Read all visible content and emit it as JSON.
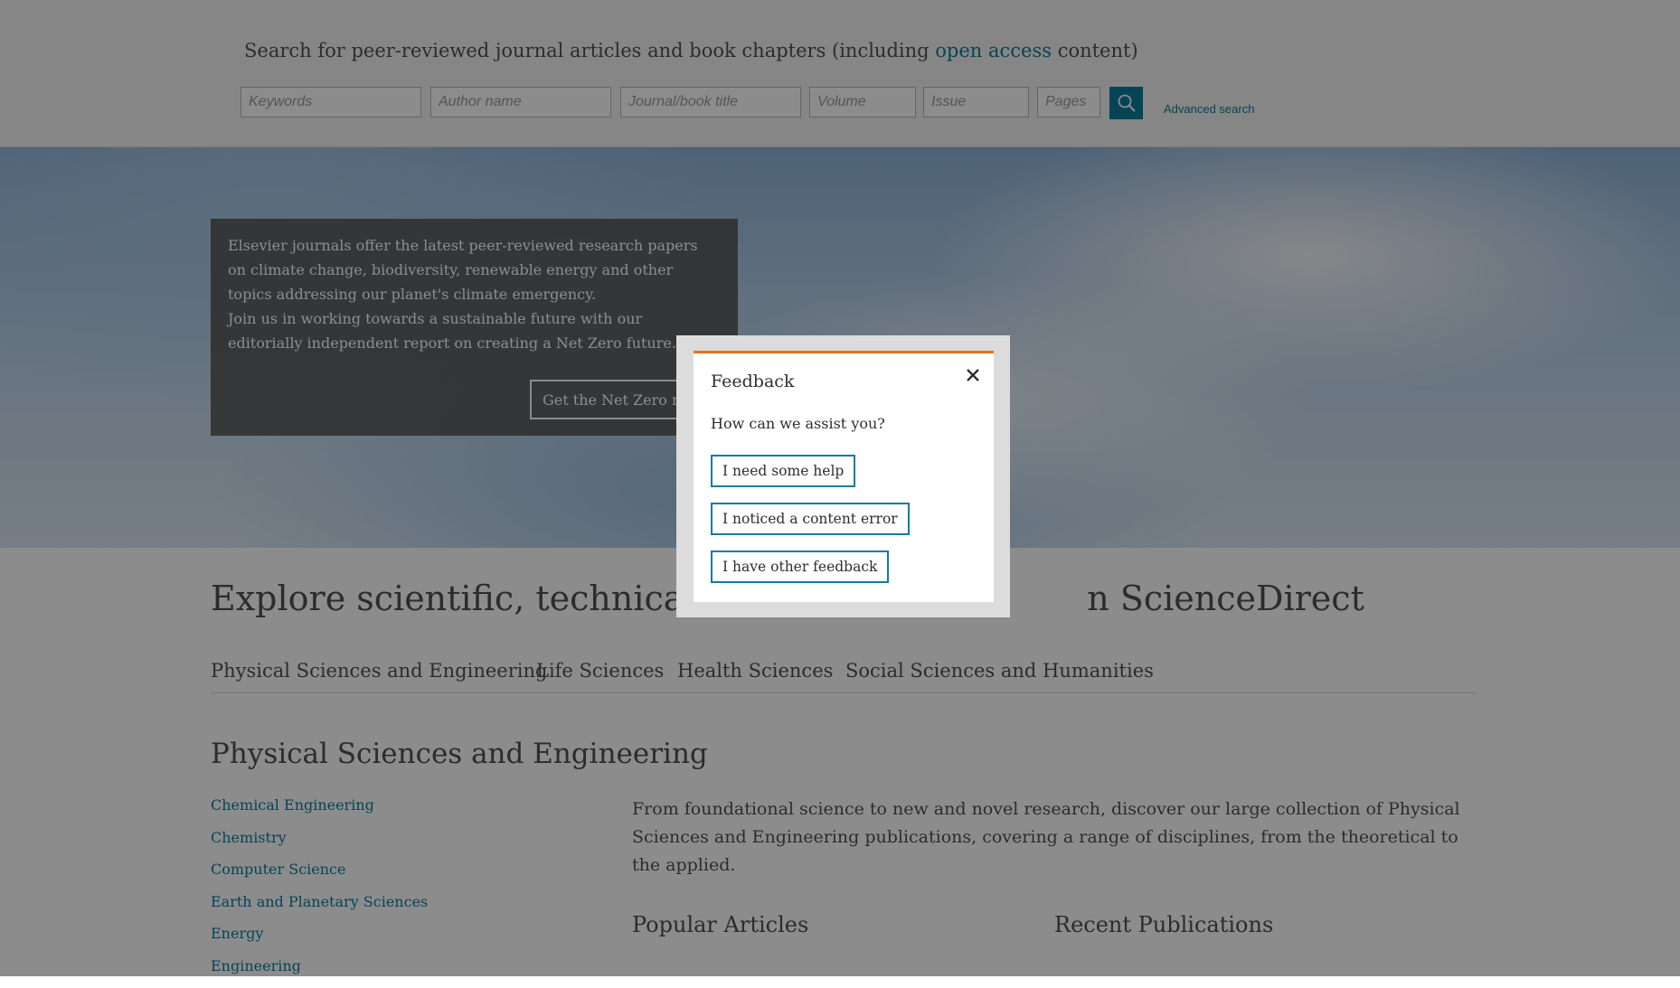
{
  "search": {
    "intro_prefix": "Search for peer-reviewed journal articles and book chapters (including ",
    "intro_link": "open access",
    "intro_suffix": " content)",
    "keywords_placeholder": "Keywords",
    "author_placeholder": "Author name",
    "journal_placeholder": "Journal/book title",
    "volume_placeholder": "Volume",
    "issue_placeholder": "Issue",
    "pages_placeholder": "Pages",
    "submit_icon": "search-icon",
    "advanced_label": "Advanced search"
  },
  "hero": {
    "paragraph1": "Elsevier journals offer the latest peer-reviewed research papers on climate change, biodiversity, renewable energy and other topics addressing our planet's climate emergency.",
    "paragraph2": "Join us in working towards a sustainable future with our editorially independent report on creating a Net Zero future.",
    "button_label": "Get the Net Zero re"
  },
  "explore": {
    "title": "Explore scientific, technical, an                              n ScienceDirect",
    "tabs": [
      {
        "label": "Physical Sciences and Engineering"
      },
      {
        "label": "Life Sciences"
      },
      {
        "label": "Health Sciences"
      },
      {
        "label": "Social Sciences and Humanities"
      }
    ]
  },
  "section": {
    "title": "Physical Sciences and Engineering",
    "disciplines": [
      {
        "label": "Chemical Engineering"
      },
      {
        "label": "Chemistry"
      },
      {
        "label": "Computer Science"
      },
      {
        "label": "Earth and Planetary Sciences"
      },
      {
        "label": "Energy"
      },
      {
        "label": "Engineering"
      }
    ],
    "description": "From foundational science to new and novel research, discover our large collection of Physical Sciences and Engineering publications, covering a range of disciplines, from the theoretical to the applied.",
    "popular_title": "Popular Articles",
    "recent_title": "Recent Publications"
  },
  "feedback_modal": {
    "title": "Feedback",
    "close_icon": "close-icon",
    "question": "How can we assist you?",
    "options": [
      {
        "label": "I need some help"
      },
      {
        "label": "I noticed a content error"
      },
      {
        "label": "I have other feedback"
      }
    ]
  },
  "colors": {
    "accent": "#0c7d9d",
    "modal_top_border": "#e9711c"
  }
}
